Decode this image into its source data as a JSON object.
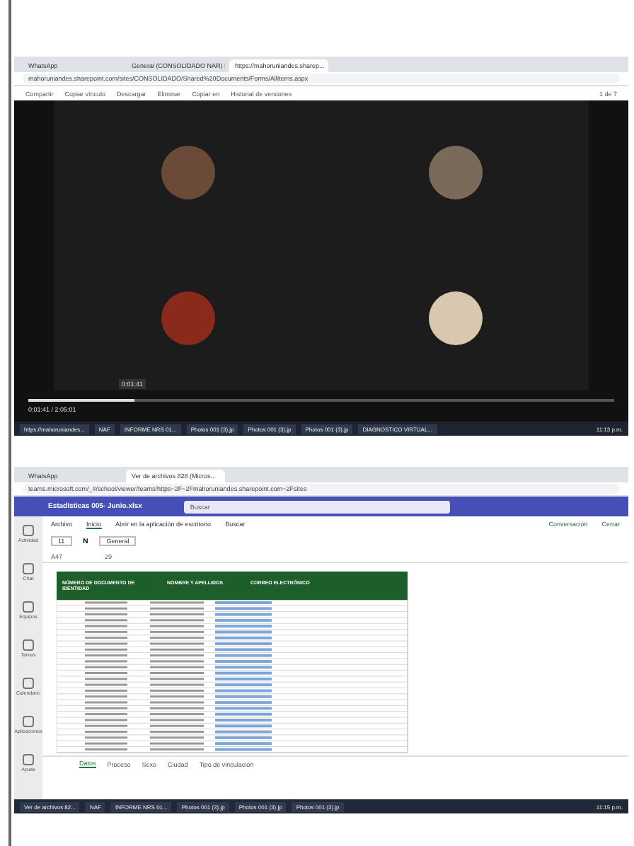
{
  "meeting_screen": {
    "tabs": [
      {
        "label": "WhatsApp",
        "selected": false
      },
      {
        "label": "General (CONSOLIDADO NAR) |",
        "selected": false
      },
      {
        "label": "https://mahoruniandes.sharep...",
        "selected": true
      }
    ],
    "url": "mahoruniandes.sharepoint.com/sites/CONSOLIDADO/Shared%20Documents/Forms/AllItems.aspx",
    "toolbar": [
      "Compartir",
      "Copiar vínculo",
      "Descargar",
      "Eliminar",
      "Copiar en",
      "Historial de versiones"
    ],
    "page_count": "1 de 7",
    "video": {
      "level": 0.18,
      "tooltip": "0:01:41",
      "time": "0:01:41 / 2:05:01"
    },
    "taskbar": [
      "https://mahoruniandes...",
      "NAF",
      "INFORME NRS 01...",
      "Photos 001 (3).jp",
      "Photos 001 (3).jp",
      "Photos 001 (3).jp",
      "DIAGNOSTICO VIRTUAL..."
    ],
    "clock": "11:13 p.m."
  },
  "sheet_screen": {
    "tabs": [
      {
        "label": "WhatsApp",
        "selected": false
      },
      {
        "label": "Ver de archivos 828 (Micros...",
        "selected": true
      }
    ],
    "url": "teams.microsoft.com/_#/school/viewer/teams/https~2F~2Fmahoruniandes.sharepoint.com~2Fsites",
    "app_title": "Estadísticas 005- Junio.xlsx",
    "search_placeholder": "Buscar",
    "rail": [
      "Actividad",
      "Chat",
      "Equipos",
      "Tareas",
      "Calendario",
      "Aplicaciones",
      "Ayuda"
    ],
    "ribbon_tabs": [
      {
        "label": "Archivo",
        "selected": false
      },
      {
        "label": "Inicio",
        "selected": true
      },
      {
        "label": "Abrir en la aplicación de escritorio",
        "selected": false
      },
      {
        "label": "Buscar",
        "selected": false
      }
    ],
    "actions": [
      "Conversación",
      "Cerrar"
    ],
    "font_size": "11",
    "bold": "N",
    "number_format": "General",
    "cell_ref": "A47",
    "formula": "29",
    "columns": [
      "NÚMERO DE DOCUMENTO DE IDENTIDAD",
      "NOMBRE Y APELLIDOS",
      "CORREO ELECTRÓNICO"
    ],
    "sheets": [
      {
        "label": "Datos",
        "selected": true
      },
      {
        "label": "Proceso",
        "selected": false
      },
      {
        "label": "Sexo",
        "selected": false
      },
      {
        "label": "Ciudad",
        "selected": false
      },
      {
        "label": "Tipo de vinculación",
        "selected": false
      }
    ],
    "taskbar": [
      "Ver de archivos 82...",
      "NAF",
      "INFORME NRS 01...",
      "Photos 001 (3).jp",
      "Photos 001 (3).jp",
      "Photos 001 (3).jp"
    ],
    "clock": "11:15 p.m."
  }
}
